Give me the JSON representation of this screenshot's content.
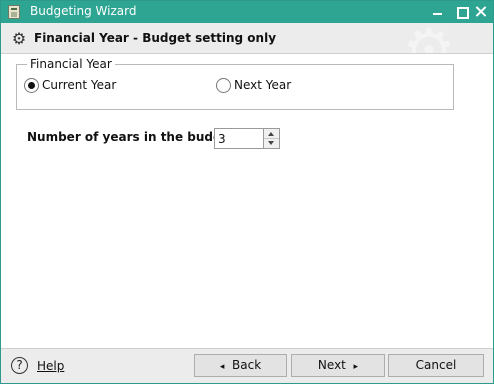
{
  "window": {
    "title": "Budgeting Wizard"
  },
  "header": {
    "title": "Financial Year - Budget setting only"
  },
  "financial_year": {
    "group_label": "Financial Year",
    "options": [
      {
        "label": "Current Year",
        "selected": true
      },
      {
        "label": "Next Year",
        "selected": false
      }
    ]
  },
  "years": {
    "label": "Number of years in the budget",
    "value": "3"
  },
  "footer": {
    "help_label": "Help",
    "help_icon": "?",
    "back_label": "Back",
    "back_arrow": "◂",
    "next_label": "Next",
    "next_arrow": "▸",
    "cancel_label": "Cancel"
  },
  "colors": {
    "title_bar": "#2ea592",
    "header_bg": "#ececec"
  }
}
